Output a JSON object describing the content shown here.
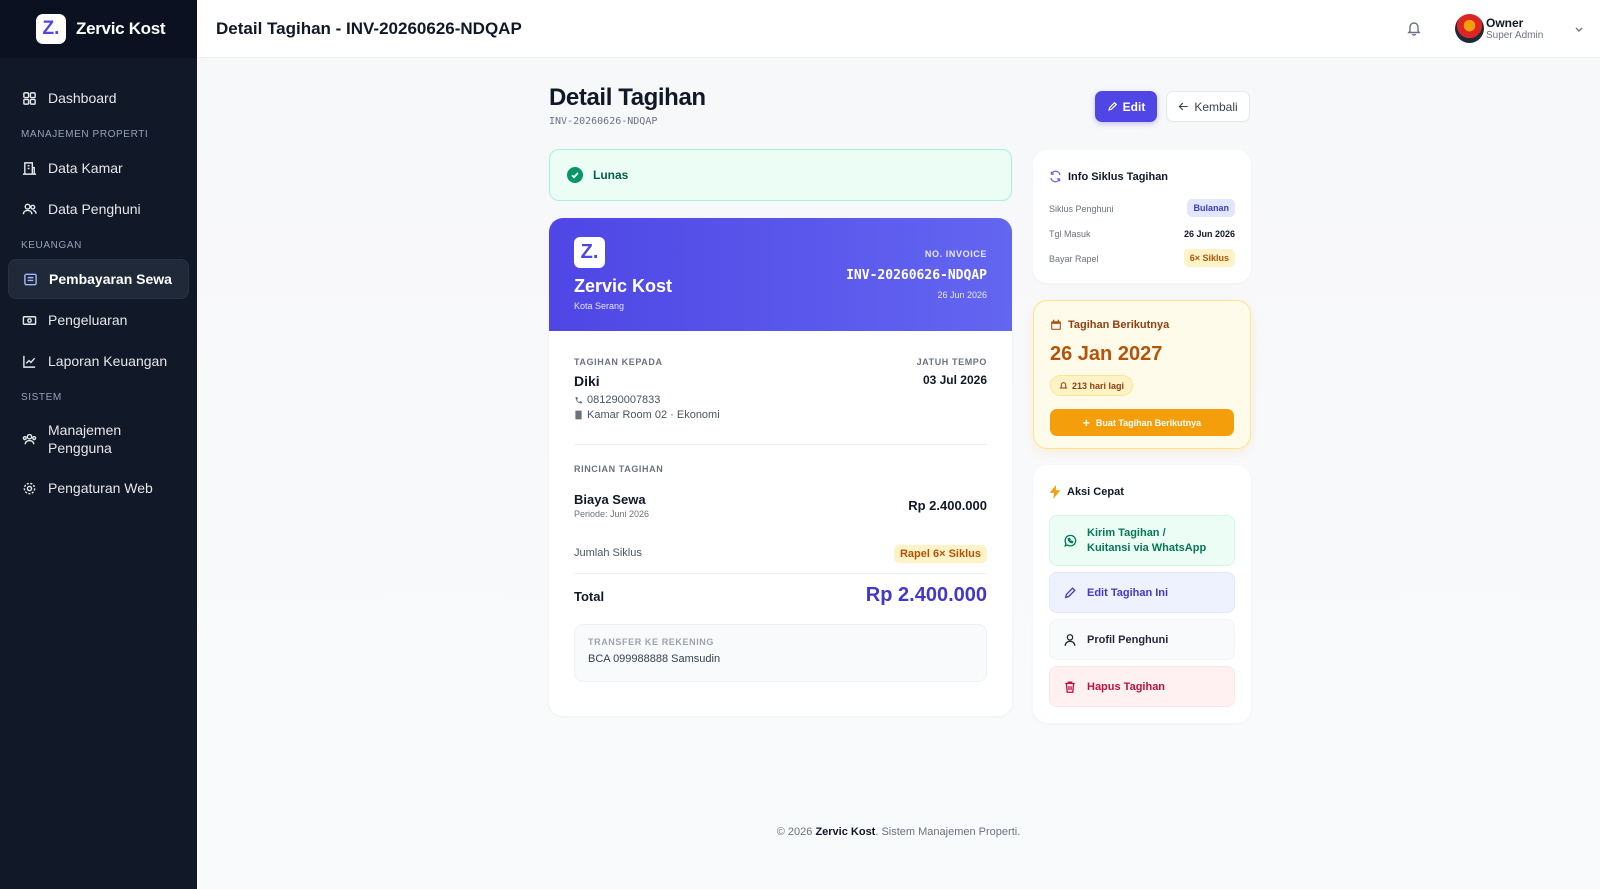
{
  "brand": {
    "name": "Zervic Kost",
    "logo_letter": "Z."
  },
  "sidebar": {
    "items": [
      {
        "label": "Dashboard",
        "icon": "grid-icon"
      },
      {
        "section": "MANAJEMEN PROPERTI"
      },
      {
        "label": "Data Kamar",
        "icon": "building-icon"
      },
      {
        "label": "Data Penghuni",
        "icon": "users-icon"
      },
      {
        "section": "KEUANGAN"
      },
      {
        "label": "Pembayaran Sewa",
        "icon": "receipt-icon",
        "active": true
      },
      {
        "label": "Pengeluaran",
        "icon": "cash-icon"
      },
      {
        "label": "Laporan Keuangan",
        "icon": "chart-line-icon"
      },
      {
        "section": "SISTEM"
      },
      {
        "label": "Manajemen Pengguna",
        "icon": "user-group-icon"
      },
      {
        "label": "Pengaturan Web",
        "icon": "gear-icon"
      }
    ]
  },
  "header": {
    "title": "Detail Tagihan - INV-20260626-NDQAP",
    "user_name": "Owner",
    "user_role": "Super Admin"
  },
  "page": {
    "title": "Detail Tagihan",
    "subtitle": "INV-20260626-NDQAP",
    "edit_label": "Edit",
    "back_label": "Kembali",
    "status": "Lunas"
  },
  "invoice": {
    "brand": "Zervic Kost",
    "city": "Kota Serang",
    "no_label": "NO. INVOICE",
    "no": "INV-20260626-NDQAP",
    "date": "26 Jun 2026",
    "bill_to_label": "TAGIHAN KEPADA",
    "tenant_name": "Diki",
    "phone": "081290007833",
    "room": "Kamar Room 02 · Ekonomi",
    "due_label": "JATUH TEMPO",
    "due_date": "03 Jul 2026",
    "detail_label": "RINCIAN TAGIHAN",
    "item_name": "Biaya Sewa",
    "item_period": "Periode: Juni 2026",
    "item_amount": "Rp 2.400.000",
    "cycles_label": "Jumlah Siklus",
    "cycles_value": "Rapel 6× Siklus",
    "total_label": "Total",
    "total_amount": "Rp 2.400.000",
    "bank_label": "TRANSFER KE REKENING",
    "bank_value": "BCA 099988888 Samsudin"
  },
  "cycle_info": {
    "title": "Info Siklus Tagihan",
    "rows": [
      {
        "label": "Siklus Penghuni",
        "value": "Bulanan"
      },
      {
        "label": "Tgl Masuk",
        "value": "26 Jun 2026"
      },
      {
        "label": "Bayar Rapel",
        "value": "6× Siklus"
      }
    ]
  },
  "next_bill": {
    "title": "Tagihan Berikutnya",
    "date": "26 Jan 2027",
    "days_left": "213 hari lagi",
    "button_label": "Buat Tagihan Berikutnya"
  },
  "quick_actions": {
    "title": "Aksi Cepat",
    "items": [
      {
        "label": "Kirim Tagihan / Kuitansi via WhatsApp",
        "icon": "whatsapp-icon",
        "color": "#047857",
        "bg": "#ecfdf5"
      },
      {
        "label": "Edit Tagihan Ini",
        "icon": "pencil-icon",
        "color": "#4338ca",
        "bg": "#eef2ff"
      },
      {
        "label": "Profil Penghuni",
        "icon": "user-icon",
        "color": "#1f2937",
        "bg": "#f9fafb"
      },
      {
        "label": "Hapus Tagihan",
        "icon": "trash-icon",
        "color": "#be123c",
        "bg": "#fff1f2"
      }
    ]
  },
  "footer": {
    "prefix": "© 2026",
    "brand": "Zervic Kost",
    "suffix": ". Sistem Manajemen Properti."
  },
  "colors": {
    "accent": "#4f46e5",
    "success": "#059669",
    "warning": "#f59e0b",
    "danger": "#be123c",
    "sidebar": "#111827"
  }
}
